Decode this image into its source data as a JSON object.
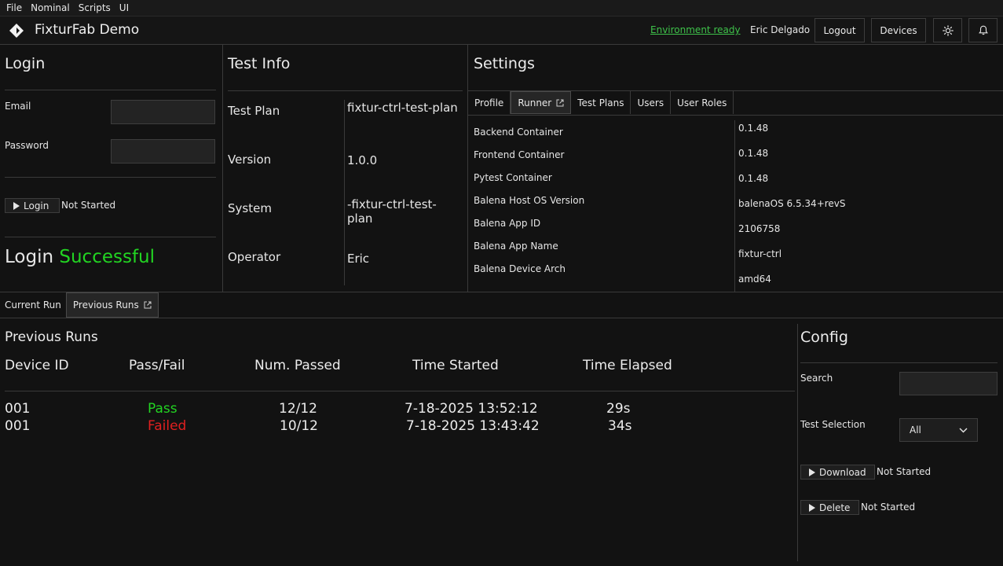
{
  "menu": [
    "File",
    "Nominal",
    "Scripts",
    "UI"
  ],
  "header": {
    "app_title": "FixturFab Demo",
    "env_status": "Environment ready",
    "user_name": "Eric Delgado",
    "logout_label": "Logout",
    "devices_label": "Devices",
    "theme_icon": "sun-icon",
    "notifications_icon": "bell-icon"
  },
  "login": {
    "title": "Login",
    "email_label": "Email",
    "email_value": "",
    "password_label": "Password",
    "password_value": "",
    "login_button": "Login",
    "login_status": "Not Started",
    "result_prefix": "Login",
    "result_word": "Successful",
    "result_color": "#22d422"
  },
  "test_info": {
    "title": "Test Info",
    "rows": [
      {
        "label": "Test Plan",
        "value": "fixtur-ctrl-test-plan"
      },
      {
        "label": "Version",
        "value": "1.0.0"
      },
      {
        "label": "System",
        "value": "-fixtur-ctrl-test-plan"
      },
      {
        "label": "Operator",
        "value": "Eric"
      }
    ]
  },
  "settings": {
    "title": "Settings",
    "tabs": [
      "Profile",
      "Runner",
      "Test Plans",
      "Users",
      "User Roles"
    ],
    "active_tab": "Runner",
    "rows": [
      {
        "label": "Backend Container",
        "value": "0.1.48"
      },
      {
        "label": "Frontend Container",
        "value": "0.1.48"
      },
      {
        "label": "Pytest Container",
        "value": "0.1.48"
      },
      {
        "label": "Balena Host OS Version",
        "value": "balenaOS 6.5.34+revS"
      },
      {
        "label": "Balena App ID",
        "value": "2106758"
      },
      {
        "label": "Balena App Name",
        "value": "fixtur-ctrl"
      },
      {
        "label": "Balena Device Arch",
        "value": "amd64"
      }
    ]
  },
  "run_tabs": [
    "Current Run",
    "Previous Runs"
  ],
  "active_run_tab": "Previous Runs",
  "previous_runs": {
    "title": "Previous Runs",
    "columns": [
      "Device ID",
      "Pass/Fail",
      "Num. Passed",
      "Time Started",
      "Time Elapsed"
    ],
    "rows": [
      {
        "device_id": "001",
        "result": "Pass",
        "num_passed": "12/12",
        "time_started": "7-18-2025 13:52:12",
        "time_elapsed": "29s"
      },
      {
        "device_id": "001",
        "result": "Failed",
        "num_passed": "10/12",
        "time_started": "7-18-2025 13:43:42",
        "time_elapsed": "34s"
      }
    ]
  },
  "config": {
    "title": "Config",
    "search_label": "Search",
    "search_value": "",
    "test_selection_label": "Test Selection",
    "test_selection_value": "All",
    "download_label": "Download",
    "download_status": "Not Started",
    "delete_label": "Delete",
    "delete_status": "Not Started"
  },
  "colors": {
    "background": "#121212",
    "env_ready": "#3ec24a",
    "pass": "#22d422",
    "fail": "#e02020"
  }
}
